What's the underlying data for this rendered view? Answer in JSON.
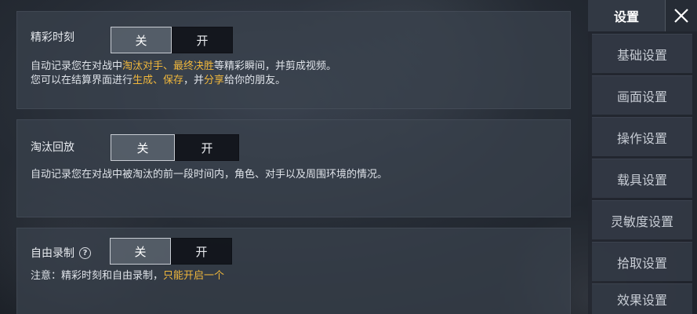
{
  "cards": {
    "highlights": {
      "title": "精彩时刻",
      "off_label": "关",
      "on_label": "开",
      "line1": [
        "自动记录您在对战中",
        "淘汰对手、最终决胜",
        "等精彩瞬间，并剪成视频。"
      ],
      "line2": [
        "您可以在结算界面进行",
        "生成、保存",
        "，并",
        "分享",
        "给你的朋友。"
      ]
    },
    "elimination": {
      "title": "淘汰回放",
      "off_label": "关",
      "on_label": "开",
      "line1": "自动记录您在对战中被淘汰的前一段时间内，角色、对手以及周围环境的情况。"
    },
    "free_record": {
      "title": "自由录制",
      "help_glyph": "?",
      "off_label": "关",
      "on_label": "开",
      "line1": [
        "注意：精彩时刻和自由录制，",
        "只能开启一个"
      ]
    }
  },
  "sidebar": {
    "title": "设置",
    "items": [
      {
        "label": "基础设置"
      },
      {
        "label": "画面设置"
      },
      {
        "label": "操作设置"
      },
      {
        "label": "载具设置"
      },
      {
        "label": "灵敏度设置"
      },
      {
        "label": "拾取设置"
      },
      {
        "label": "效果设置"
      }
    ]
  },
  "icons": {
    "close": "close-icon",
    "help": "question-circle-icon"
  },
  "colors": {
    "highlight": "#f0b73c",
    "selected_option_bg": "#6e7682",
    "unselected_option_bg": "#0e1116"
  }
}
